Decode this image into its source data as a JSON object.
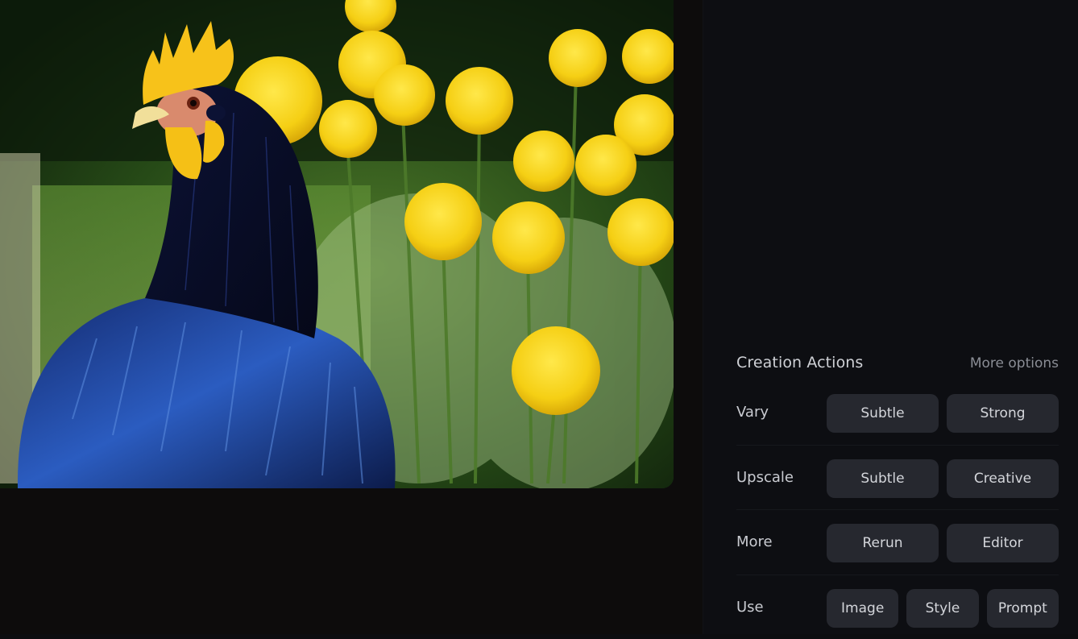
{
  "image": {
    "description": "Black rooster with yellow comb and wattles in front of yellow dandelion-like flowers",
    "colors": {
      "background_green": "#1d3a14",
      "flower_yellow": "#f5d21c",
      "feather_blue": "#1b3f9a",
      "feather_black": "#0a0f2a",
      "comb_yellow": "#f7c21a"
    }
  },
  "panel": {
    "title": "Creation Actions",
    "more_options": "More options",
    "rows": [
      {
        "label": "Vary",
        "buttons": [
          "Subtle",
          "Strong"
        ]
      },
      {
        "label": "Upscale",
        "buttons": [
          "Subtle",
          "Creative"
        ]
      },
      {
        "label": "More",
        "buttons": [
          "Rerun",
          "Editor"
        ]
      },
      {
        "label": "Use",
        "buttons": [
          "Image",
          "Style",
          "Prompt"
        ]
      }
    ]
  },
  "colors": {
    "page_bg": "#0c0d10",
    "button_bg": "#26282f",
    "button_text": "#d4d6db",
    "title_text": "#cfd1d6",
    "muted_text": "#8a8d95"
  }
}
